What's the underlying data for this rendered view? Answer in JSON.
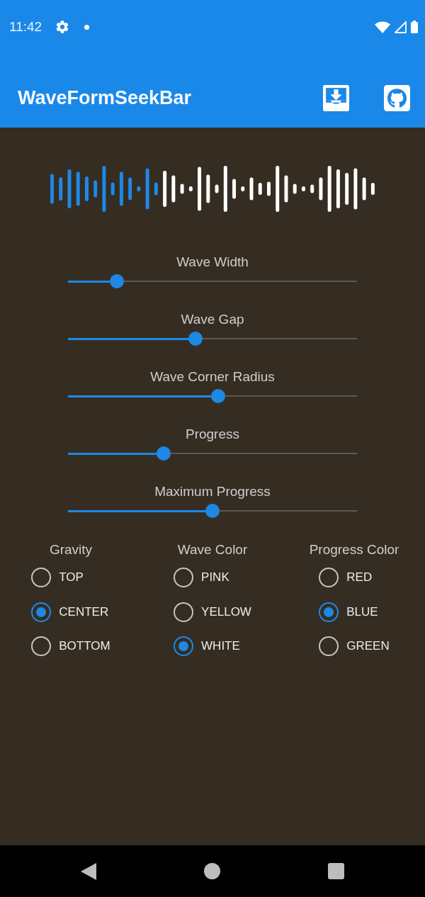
{
  "status_bar": {
    "time": "11:42"
  },
  "app_bar": {
    "title": "WaveFormSeekBar"
  },
  "sliders": [
    {
      "label": "Wave Width",
      "level": 0.17
    },
    {
      "label": "Wave Gap",
      "level": 0.44
    },
    {
      "label": "Wave Corner Radius",
      "level": 0.52
    },
    {
      "label": "Progress",
      "level": 0.33
    },
    {
      "label": "Maximum Progress",
      "level": 0.5
    }
  ],
  "radio_groups": [
    {
      "title": "Gravity",
      "options": [
        {
          "label": "TOP",
          "selected": false
        },
        {
          "label": "CENTER",
          "selected": true
        },
        {
          "label": "BOTTOM",
          "selected": false
        }
      ]
    },
    {
      "title": "Wave Color",
      "options": [
        {
          "label": "PINK",
          "selected": false
        },
        {
          "label": "YELLOW",
          "selected": false
        },
        {
          "label": "WHITE",
          "selected": true
        }
      ]
    },
    {
      "title": "Progress Color",
      "options": [
        {
          "label": "RED",
          "selected": false
        },
        {
          "label": "BLUE",
          "selected": true
        },
        {
          "label": "GREEN",
          "selected": false
        }
      ]
    }
  ]
}
